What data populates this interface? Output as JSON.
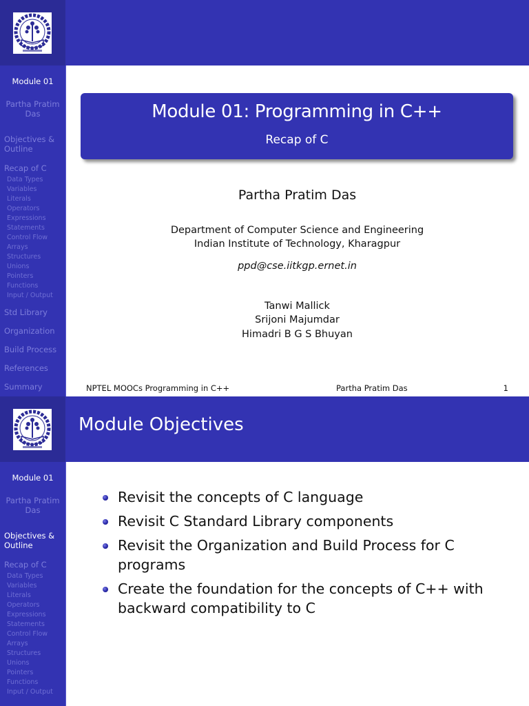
{
  "colors": {
    "header_bar": "#3333b2",
    "sidebar": "#3333b2",
    "logo_corner": "#2b2b96",
    "sidebar_inactive_text": "#7d7ddb",
    "sidebar_active_text": "#ffffff",
    "bullet": "#2a2aa8"
  },
  "logo": {
    "icon": "iit-kharagpur-logo"
  },
  "sidebar": {
    "module": "Module 01",
    "author_line1": "Partha Pratim",
    "author_line2": "Das",
    "objectives_line1": "Objectives &",
    "objectives_line2": "Outline",
    "recap": "Recap of C",
    "recap_subitems": [
      "Data Types",
      "Variables",
      "Literals",
      "Operators",
      "Expressions",
      "Statements",
      "Control Flow",
      "Arrays",
      "Structures",
      "Unions",
      "Pointers",
      "Functions",
      "Input / Output"
    ],
    "sections_after": [
      "Std Library",
      "Organization",
      "Build Process",
      "References",
      "Summary"
    ]
  },
  "slide1": {
    "title": "Module 01: Programming in C++",
    "subtitle": "Recap of C",
    "author": "Partha Pratim Das",
    "institute_line1": "Department of Computer Science and Engineering",
    "institute_line2": "Indian Institute of Technology, Kharagpur",
    "email": "ppd@cse.iitkgp.ernet.in",
    "contributors": [
      "Tanwi Mallick",
      "Srijoni Majumdar",
      "Himadri B G S Bhuyan"
    ],
    "footer": {
      "left": "NPTEL MOOCs Programming in C++",
      "middle": "Partha Pratim Das",
      "page": "1"
    }
  },
  "slide2": {
    "frame_title": "Module Objectives",
    "bullets": [
      "Revisit the concepts of C language",
      "Revisit C Standard Library components",
      "Revisit the Organization and Build Process for C programs",
      "Create the foundation for the concepts of C++ with backward compatibility to C"
    ]
  }
}
